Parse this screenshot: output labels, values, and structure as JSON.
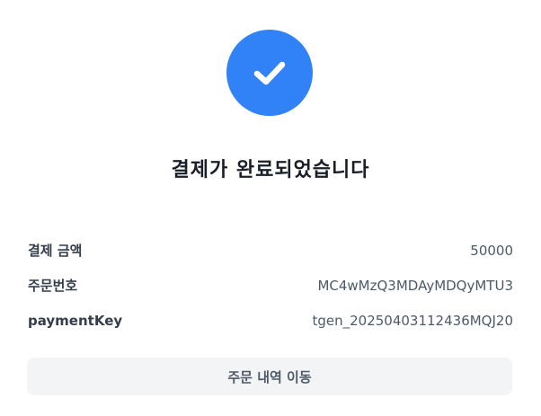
{
  "colors": {
    "accent": "#3182f6"
  },
  "status_icon": "check-icon",
  "title": "결제가 완료되었습니다",
  "details": [
    {
      "label": "결제 금액",
      "value": "50000"
    },
    {
      "label": "주문번호",
      "value": "MC4wMzQ3MDAyMDQyMTU3"
    },
    {
      "label": "paymentKey",
      "value": "tgen_20250403112436MQJ20"
    }
  ],
  "actions": {
    "order_history_label": "주문 내역 이동"
  }
}
